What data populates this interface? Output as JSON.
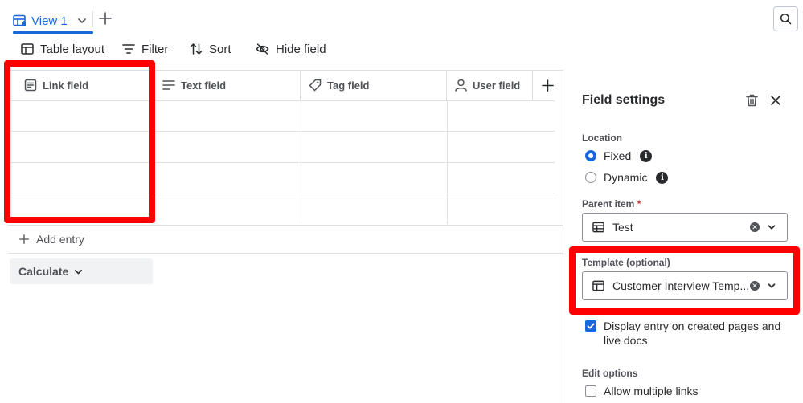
{
  "tabs": {
    "view_label": "View 1"
  },
  "toolbar": {
    "table_layout": "Table layout",
    "filter": "Filter",
    "sort": "Sort",
    "hide_field": "Hide field"
  },
  "table": {
    "columns": [
      {
        "label": "Link field",
        "icon": "link-field-icon"
      },
      {
        "label": "Text field",
        "icon": "text-lines-icon"
      },
      {
        "label": "Tag field",
        "icon": "tag-icon"
      },
      {
        "label": "User field",
        "icon": "user-icon"
      }
    ],
    "add_entry": "Add entry",
    "calculate": "Calculate"
  },
  "panel": {
    "title": "Field settings",
    "location_label": "Location",
    "location_options": [
      {
        "label": "Fixed",
        "selected": true
      },
      {
        "label": "Dynamic",
        "selected": false
      }
    ],
    "parent_label": "Parent item",
    "required_marker": "*",
    "parent_value": "Test",
    "template_label": "Template (optional)",
    "template_value": "Customer Interview Temp...",
    "display_entry_label": "Display entry on created pages and live docs",
    "display_entry_checked": true,
    "edit_options_label": "Edit options",
    "allow_multiple_label": "Allow multiple links",
    "allow_multiple_checked": false
  },
  "colors": {
    "accent": "#1868db",
    "highlight": "#ff0000",
    "border": "#dcdfe4",
    "text": "#292a2e"
  }
}
